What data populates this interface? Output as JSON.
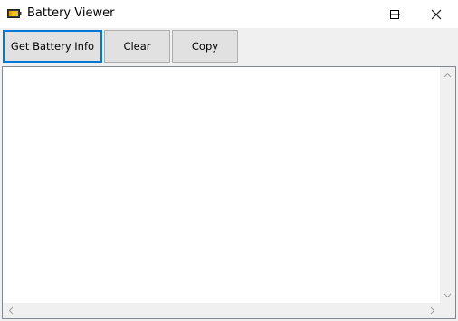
{
  "window": {
    "title": "Battery Viewer",
    "app_icon": "battery-icon",
    "controls": {
      "minimize_icon": "minimize-icon",
      "maximize_icon": "maximize-icon",
      "close_icon": "close-icon"
    }
  },
  "toolbar": {
    "get_info_label": "Get Battery Info",
    "clear_label": "Clear",
    "copy_label": "Copy"
  },
  "output": {
    "text": ""
  },
  "colors": {
    "focus_border": "#0078d7",
    "button_face": "#e1e1e1",
    "button_border": "#adadad",
    "battery_fill": "#f0c020"
  }
}
